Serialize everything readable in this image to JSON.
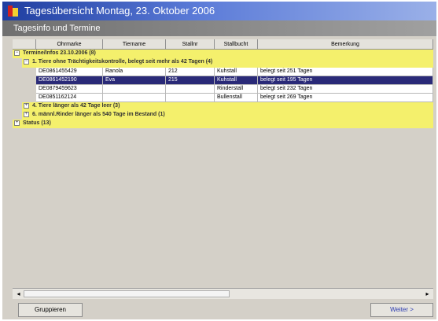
{
  "window": {
    "title": "Tagesübersicht Montag, 23. Oktober 2006"
  },
  "subheader": {
    "title": "Tagesinfo und Termine"
  },
  "columns": [
    "Ohrmarke",
    "Tiername",
    "Stallnr",
    "Stallbucht",
    "Bemerkung"
  ],
  "groups": {
    "g1": "Termine/Infos 23.10.2006 (8)",
    "g1a": "1. Tiere ohne Trächtigkeitskontrolle, belegt seit mehr als 42 Tagen (4)",
    "g1b": "4. Tiere länger als 42 Tage leer (3)",
    "g1c": "6. männl.Rinder länger als 540 Tage im Bestand (1)",
    "g2": "Status (13)"
  },
  "rows": [
    [
      "DE0861455429",
      "Ranola",
      "212",
      "Kuhstall",
      "belegt seit 251 Tagen"
    ],
    [
      "DE0861452190",
      "Eva",
      "215",
      "Kuhstall",
      "belegt seit 195 Tagen"
    ],
    [
      "DE0879459623",
      "",
      "",
      "Rinderstall",
      "belegt seit 232 Tagen"
    ],
    [
      "DE0851162124",
      "",
      "",
      "Bullenstall",
      "belegt seit 269 Tagen"
    ]
  ],
  "selected_row": 1,
  "expanders": {
    "g1": "−",
    "g1a": "−",
    "g1b": "+",
    "g1c": "+",
    "g2": "+"
  },
  "buttons": {
    "left": "Gruppieren",
    "right": "Weiter >"
  },
  "scroll": {
    "left_arrow": "◂",
    "right_arrow": "▸"
  },
  "colors": {
    "title_start": "#1f3ea0",
    "group_bg": "#f4f06c",
    "selection": "#2a2a78",
    "window_bg": "#d4d0c8"
  }
}
